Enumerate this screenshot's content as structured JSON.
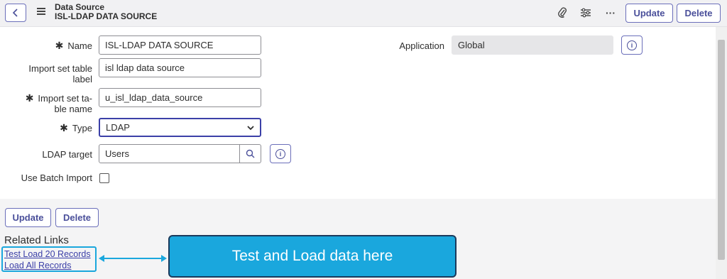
{
  "header": {
    "title_line1": "Data Source",
    "title_line2": "ISL-LDAP DATA SOURCE",
    "update_label": "Update",
    "delete_label": "Delete",
    "more_label": "···"
  },
  "form": {
    "name": {
      "label": "Name",
      "value": "ISL-LDAP DATA SOURCE",
      "required": true
    },
    "import_set_label": {
      "label_line1": "Import set table",
      "label_line2": "label",
      "value": "isl ldap data source"
    },
    "import_set_name": {
      "label_line1": "Import set ta-",
      "label_line2": "ble name",
      "value": "u_isl_ldap_data_source",
      "required": true
    },
    "type": {
      "label": "Type",
      "value": "LDAP",
      "required": true
    },
    "ldap_target": {
      "label": "LDAP target",
      "value": "Users"
    },
    "use_batch_import": {
      "label": "Use Batch Import",
      "checked": false
    },
    "application": {
      "label": "Application",
      "value": "Global"
    },
    "required_mark": "✱"
  },
  "footer": {
    "update_label": "Update",
    "delete_label": "Delete"
  },
  "related_links": {
    "title": "Related Links",
    "items": [
      "Test Load 20 Records",
      "Load All Records"
    ]
  },
  "callout": {
    "text": "Test and Load data here"
  },
  "colors": {
    "accent": "#4a4f9a",
    "callout": "#1aa7dd",
    "header_bg": "#f1f1f3"
  }
}
